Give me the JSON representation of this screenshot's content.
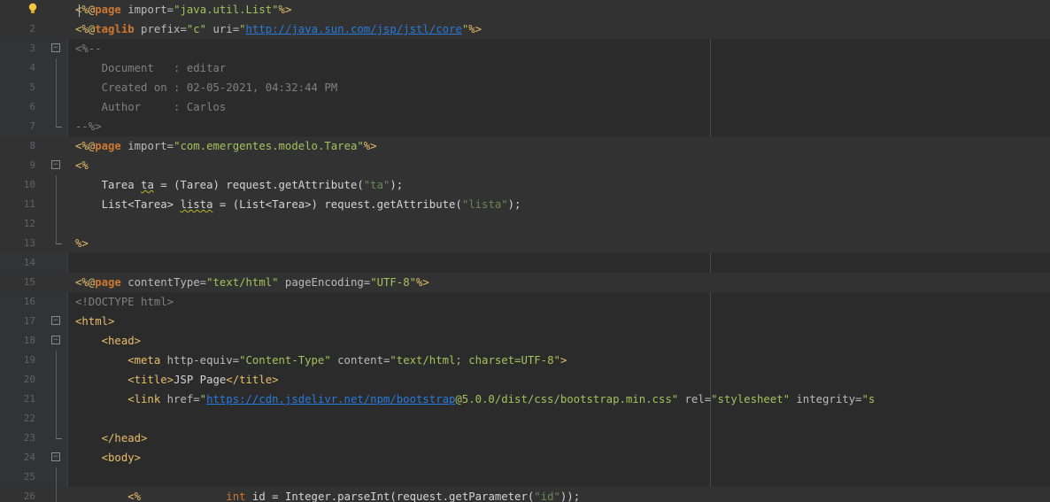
{
  "editor": {
    "lines": [
      {
        "n": "",
        "fold": "",
        "shade": true,
        "tokens": [
          [
            "t-tag",
            "<%@"
          ],
          [
            "t-tagk",
            "page"
          ],
          [
            "t-attr",
            " import="
          ],
          [
            "t-jstrb",
            "\"java.util.List\""
          ],
          [
            "t-tag",
            "%>"
          ]
        ]
      },
      {
        "n": "2",
        "fold": "",
        "shade": true,
        "tokens": [
          [
            "t-tag",
            "<%@"
          ],
          [
            "t-tagk",
            "taglib"
          ],
          [
            "t-attr",
            " prefix="
          ],
          [
            "t-jstrb",
            "\"c\""
          ],
          [
            "t-attr",
            " uri="
          ],
          [
            "t-jstrb",
            "\""
          ],
          [
            "t-url",
            "http://java.sun.com/jsp/jstl/core"
          ],
          [
            "t-jstrb",
            "\""
          ],
          [
            "t-tag",
            "%>"
          ]
        ]
      },
      {
        "n": "3",
        "fold": "open",
        "shade": false,
        "tokens": [
          [
            "t-comment",
            "<%--"
          ]
        ]
      },
      {
        "n": "4",
        "fold": "line",
        "shade": false,
        "tokens": [
          [
            "t-comment",
            "    Document   : editar"
          ]
        ]
      },
      {
        "n": "5",
        "fold": "line",
        "shade": false,
        "tokens": [
          [
            "t-comment",
            "    Created on : 02-05-2021, 04:32:44 PM"
          ]
        ]
      },
      {
        "n": "6",
        "fold": "line",
        "shade": false,
        "tokens": [
          [
            "t-comment",
            "    Author     : Carlos"
          ]
        ]
      },
      {
        "n": "7",
        "fold": "end",
        "shade": false,
        "tokens": [
          [
            "t-comment",
            "--%>"
          ]
        ]
      },
      {
        "n": "8",
        "fold": "",
        "shade": true,
        "tokens": [
          [
            "t-tag",
            "<%@"
          ],
          [
            "t-tagk",
            "page"
          ],
          [
            "t-attr",
            " import="
          ],
          [
            "t-jstrb",
            "\"com.emergentes.modelo.Tarea\""
          ],
          [
            "t-tag",
            "%>"
          ]
        ]
      },
      {
        "n": "9",
        "fold": "open",
        "shade": true,
        "tokens": [
          [
            "t-tag",
            "<%"
          ]
        ]
      },
      {
        "n": "10",
        "fold": "line",
        "shade": true,
        "tokens": [
          [
            "t-plain",
            "    Tarea "
          ],
          [
            "t-warn",
            "ta"
          ],
          [
            "t-plain",
            " = (Tarea) request.getAttribute("
          ],
          [
            "t-jstr",
            "\"ta\""
          ],
          [
            "t-plain",
            ");"
          ]
        ]
      },
      {
        "n": "11",
        "fold": "line",
        "shade": true,
        "tokens": [
          [
            "t-plain",
            "    List<Tarea> "
          ],
          [
            "t-warn",
            "lista"
          ],
          [
            "t-plain",
            " = (List<Tarea>) request.getAttribute("
          ],
          [
            "t-jstr",
            "\"lista\""
          ],
          [
            "t-plain",
            ");"
          ]
        ]
      },
      {
        "n": "12",
        "fold": "line",
        "shade": true,
        "tokens": []
      },
      {
        "n": "13",
        "fold": "end",
        "shade": true,
        "tokens": [
          [
            "t-tag",
            "%>"
          ]
        ]
      },
      {
        "n": "14",
        "fold": "",
        "shade": false,
        "tokens": []
      },
      {
        "n": "15",
        "fold": "",
        "shade": true,
        "tokens": [
          [
            "t-tag",
            "<%@"
          ],
          [
            "t-tagk",
            "page"
          ],
          [
            "t-attr",
            " contentType="
          ],
          [
            "t-jstrb",
            "\"text/html\""
          ],
          [
            "t-attr",
            " pageEncoding="
          ],
          [
            "t-jstrb",
            "\"UTF-8\""
          ],
          [
            "t-tag",
            "%>"
          ]
        ]
      },
      {
        "n": "16",
        "fold": "",
        "shade": false,
        "tokens": [
          [
            "t-comment",
            "<!DOCTYPE html>"
          ]
        ]
      },
      {
        "n": "17",
        "fold": "open",
        "shade": false,
        "tokens": [
          [
            "t-tag",
            "<html>"
          ]
        ]
      },
      {
        "n": "18",
        "fold": "open2",
        "shade": false,
        "tokens": [
          [
            "t-tag",
            "    <head>"
          ]
        ]
      },
      {
        "n": "19",
        "fold": "line",
        "shade": false,
        "tokens": [
          [
            "t-tag",
            "        <meta"
          ],
          [
            "t-attr",
            " http-equiv="
          ],
          [
            "t-jstrb",
            "\"Content-Type\""
          ],
          [
            "t-attr",
            " content="
          ],
          [
            "t-jstrb",
            "\"text/html; charset=UTF-8\""
          ],
          [
            "t-tag",
            ">"
          ]
        ]
      },
      {
        "n": "20",
        "fold": "line",
        "shade": false,
        "tokens": [
          [
            "t-tag",
            "        <title>"
          ],
          [
            "t-plain",
            "JSP Page"
          ],
          [
            "t-tag",
            "</title>"
          ]
        ]
      },
      {
        "n": "21",
        "fold": "line",
        "shade": false,
        "tokens": [
          [
            "t-tag",
            "        <link"
          ],
          [
            "t-attr",
            " href="
          ],
          [
            "t-jstrb",
            "\""
          ],
          [
            "t-url",
            "https://cdn.jsdelivr.net/npm/bootstrap"
          ],
          [
            "t-jstrb",
            "@5.0.0/dist/css/bootstrap.min.css\""
          ],
          [
            "t-attr",
            " rel="
          ],
          [
            "t-jstrb",
            "\"stylesheet\""
          ],
          [
            "t-attr",
            " integrity="
          ],
          [
            "t-jstrb",
            "\"s"
          ]
        ]
      },
      {
        "n": "22",
        "fold": "line",
        "shade": false,
        "tokens": []
      },
      {
        "n": "23",
        "fold": "end",
        "shade": false,
        "tokens": [
          [
            "t-tag",
            "    </head>"
          ]
        ]
      },
      {
        "n": "24",
        "fold": "open",
        "shade": false,
        "tokens": [
          [
            "t-tag",
            "    <body>"
          ]
        ]
      },
      {
        "n": "25",
        "fold": "line",
        "shade": false,
        "tokens": []
      },
      {
        "n": "26",
        "fold": "line",
        "shade": true,
        "tokens": [
          [
            "t-tag",
            "        <%"
          ],
          [
            "t-plain",
            "             "
          ],
          [
            "t-kw",
            "int"
          ],
          [
            "t-plain",
            " id = Integer.parseInt(request.getParameter("
          ],
          [
            "t-jstr",
            "\"id\""
          ],
          [
            "t-plain",
            "));"
          ]
        ]
      }
    ]
  }
}
